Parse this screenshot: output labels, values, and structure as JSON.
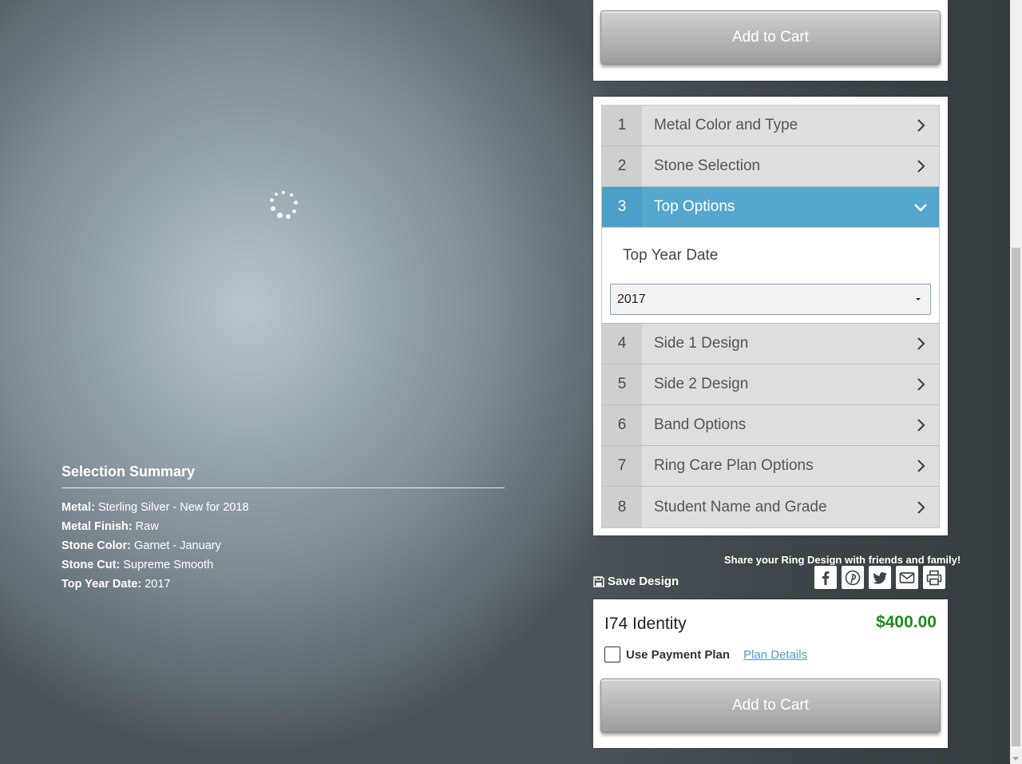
{
  "top_card": {
    "add_to_cart": "Add to Cart"
  },
  "steps": [
    {
      "num": "1",
      "label": "Metal Color and Type",
      "active": false
    },
    {
      "num": "2",
      "label": "Stone Selection",
      "active": false
    },
    {
      "num": "3",
      "label": "Top Options",
      "active": true
    },
    {
      "num": "4",
      "label": "Side 1 Design",
      "active": false
    },
    {
      "num": "5",
      "label": "Side 2 Design",
      "active": false
    },
    {
      "num": "6",
      "label": "Band Options",
      "active": false
    },
    {
      "num": "7",
      "label": "Ring Care Plan Options",
      "active": false
    },
    {
      "num": "8",
      "label": "Student Name and Grade",
      "active": false
    }
  ],
  "top_options_panel": {
    "title": "Top Year Date",
    "selected_year": "2017"
  },
  "summary": {
    "title": "Selection Summary",
    "items": [
      {
        "key": "Metal:",
        "value": "Sterling Silver - New for 2018"
      },
      {
        "key": "Metal Finish:",
        "value": "Raw"
      },
      {
        "key": "Stone Color:",
        "value": "Garnet - January"
      },
      {
        "key": "Stone Cut:",
        "value": "Supreme Smooth"
      },
      {
        "key": "Top Year Date:",
        "value": "2017"
      }
    ]
  },
  "share": {
    "text": "Share your Ring Design with friends and family!",
    "save_label": "Save Design",
    "icons": [
      "facebook-icon",
      "pinterest-icon",
      "twitter-icon",
      "email-icon",
      "print-icon"
    ]
  },
  "product": {
    "name": "I74 Identity",
    "price": "$400.00",
    "payment_plan_label": "Use Payment Plan",
    "plan_details_link": "Plan Details",
    "add_to_cart": "Add to Cart"
  },
  "colors": {
    "accent": "#55a7cf",
    "price": "#1e8a1e",
    "link": "#4f9cc7"
  }
}
